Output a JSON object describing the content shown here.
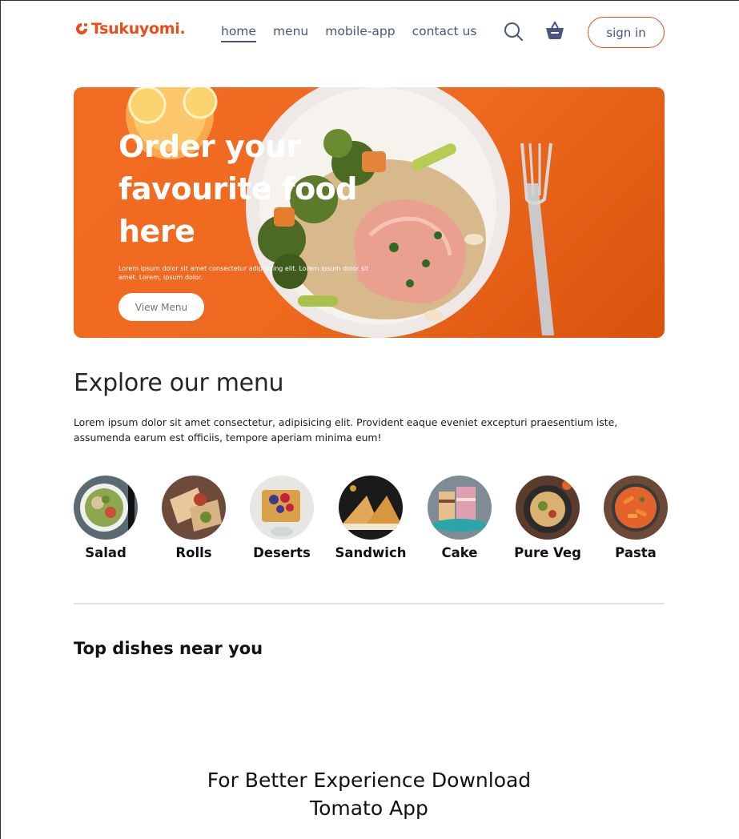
{
  "navbar": {
    "logo_text": "Tsukuyomi.",
    "links": [
      {
        "label": "home",
        "active": true
      },
      {
        "label": "menu",
        "active": false
      },
      {
        "label": "mobile-app",
        "active": false
      },
      {
        "label": "contact us",
        "active": false
      }
    ],
    "search_icon": "search-icon",
    "basket_icon": "basket-icon",
    "signin_label": "sign in"
  },
  "hero": {
    "title_line1": "Order your",
    "title_line2": "favourite food",
    "title_line3": "here",
    "subtitle": "Lorem ipsum dolor sit amet consectetur adipisicing elit. Lorem ipsum dolor sit amet. Lorem, ipsum dolor.",
    "button_label": "View Menu"
  },
  "explore": {
    "title": "Explore our menu",
    "text": "Lorem ipsum dolor sit amet consectetur, adipisicing elit. Provident eaque eveniet excepturi praesentium iste, assumenda earum est officiis, tempore aperiam minima eum!",
    "items": [
      {
        "label": "Salad"
      },
      {
        "label": "Rolls"
      },
      {
        "label": "Deserts"
      },
      {
        "label": "Sandwich"
      },
      {
        "label": "Cake"
      },
      {
        "label": "Pure Veg"
      },
      {
        "label": "Pasta"
      }
    ]
  },
  "top_dishes": {
    "title": "Top dishes near you"
  },
  "app_download": {
    "line1": "For Better Experience Download",
    "line2": "Tomato App"
  },
  "colors": {
    "accent": "#ea4c1a",
    "nav_text": "#49557e",
    "hero_bg": "#f26b23"
  }
}
